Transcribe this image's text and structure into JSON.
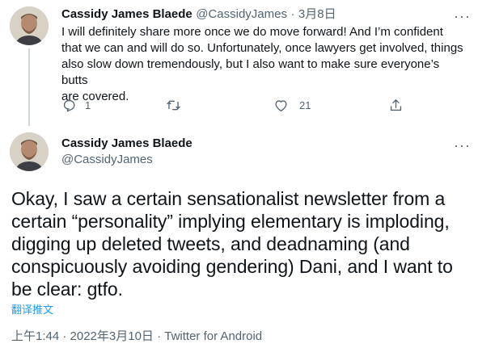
{
  "reply": {
    "author_name": "Cassidy James Blaede",
    "author_handle": "@CassidyJames",
    "separator": "·",
    "date": "3月8日",
    "text_lines": [
      "I will definitely share more once we do move forward! And I’m confident",
      "that we can and will do so. Unfortunately, once lawyers get involved, things",
      "also slow down tremendously, but I also want to make sure everyone’s butts",
      "are covered."
    ],
    "reply_count": "1",
    "retweet_count": "",
    "like_count": "21",
    "more_label": "···"
  },
  "main": {
    "author_name": "Cassidy James Blaede",
    "author_handle": "@CassidyJames",
    "more_label": "···",
    "text_lines": [
      "Okay, I saw a certain sensationalist newsletter from a",
      "certain “personality” implying elementary is imploding,",
      "digging up deleted tweets, and deadnaming (and",
      "conspicuously avoiding gendering) Dani, and I want to",
      "be clear: gtfo."
    ],
    "translate_label": "翻译推文",
    "timestamp": "上午1:44 · 2022年3月10日 · Twitter for Android"
  },
  "colors": {
    "text": "#0f1419",
    "muted": "#536471",
    "link": "#1d9bf0",
    "thread_line": "#cfd9de"
  },
  "icons": [
    "reply-icon",
    "retweet-icon",
    "like-icon",
    "share-icon",
    "more-icon",
    "avatar"
  ]
}
